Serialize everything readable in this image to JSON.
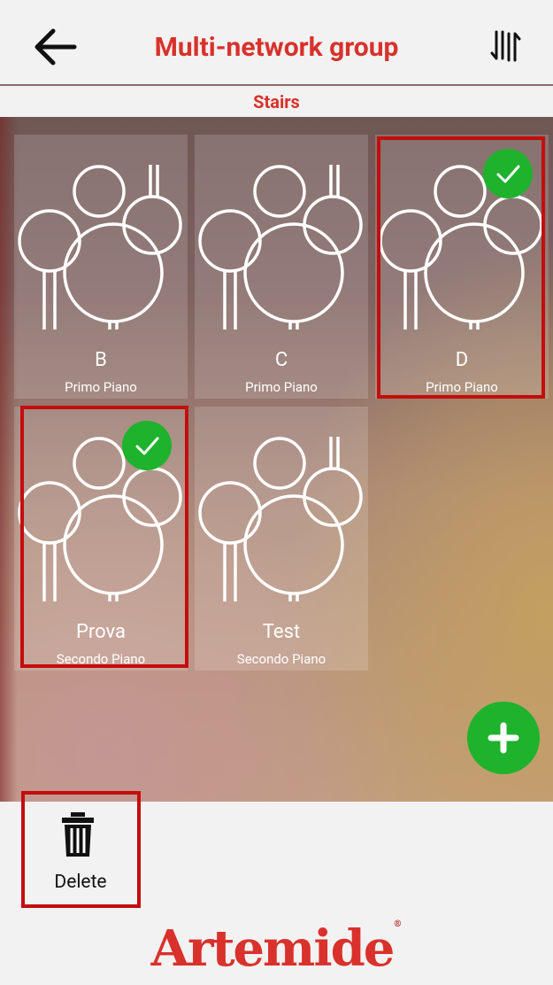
{
  "header": {
    "title": "Multi-network group",
    "back_icon": "back-arrow-icon",
    "sort_icon": "sort-arrows-icon"
  },
  "subtitle": "Stairs",
  "tiles": [
    {
      "name": "B",
      "floor": "Primo Piano",
      "selected": false
    },
    {
      "name": "C",
      "floor": "Primo Piano",
      "selected": false
    },
    {
      "name": "D",
      "floor": "Primo Piano",
      "selected": true
    },
    {
      "name": "Prova",
      "floor": "Secondo Piano",
      "selected": true
    },
    {
      "name": "Test",
      "floor": "Secondo Piano",
      "selected": false
    }
  ],
  "actions": {
    "delete_label": "Delete",
    "delete_icon": "trash-icon",
    "add_icon": "plus-icon"
  },
  "brand": {
    "logo_text": "Artemide",
    "registered_mark": "®"
  },
  "colors": {
    "accent_red": "#d9312b",
    "check_green": "#1fb22d",
    "highlight_red": "#c40d0d"
  }
}
